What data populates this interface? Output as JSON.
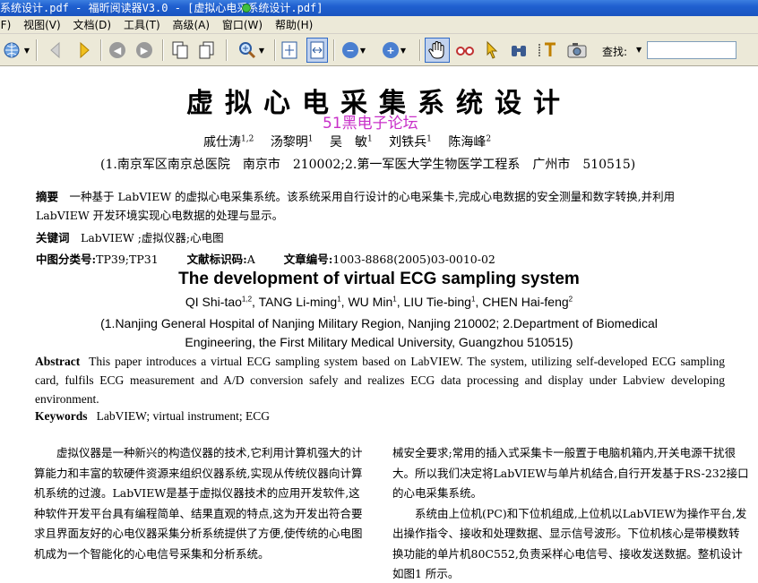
{
  "window": {
    "title_part1": "系统设计.pdf - 福昕阅读器V3.0 - [虚拟心电采",
    "title_part2": "系统设计.pdf]"
  },
  "menu": [
    "(F)",
    "视图(V)",
    "文档(D)",
    "工具(T)",
    "高级(A)",
    "窗口(W)",
    "帮助(H)"
  ],
  "toolbar": {
    "find_label": "查找:",
    "find_value": ""
  },
  "colors": {
    "titlebar": "#1f5fcf",
    "chrome": "#ece9d8",
    "watermark": "#c830c8"
  },
  "document": {
    "cn_title": "虚拟心电采集系统设计",
    "watermark": "51黑电子论坛",
    "cn_authors": [
      {
        "name": "戚仕涛",
        "sup": "1,2"
      },
      {
        "name": "汤黎明",
        "sup": "1"
      },
      {
        "name": "吴　敏",
        "sup": "1"
      },
      {
        "name": "刘铁兵",
        "sup": "1"
      },
      {
        "name": "陈海峰",
        "sup": "2"
      }
    ],
    "cn_affiliation": "(1.南京军区南京总医院　南京市　210002;2.第一军医大学生物医学工程系　广州市　510515)",
    "cn_abstract_label": "摘要",
    "cn_abstract": "一种基于 LabVIEW 的虚拟心电采集系统。该系统采用自行设计的心电采集卡,完成心电数据的安全测量和数字转换,并利用 LabVIEW 开发环境实现心电数据的处理与显示。",
    "cn_keywords_label": "关键词",
    "cn_keywords": "LabVIEW ;虚拟仪器;心电图",
    "cn_class_label": "中图分类号:",
    "cn_class": "TP39;TP31",
    "cn_doc_code_label": "文献标识码:",
    "cn_doc_code": "A",
    "cn_article_no_label": "文章编号:",
    "cn_article_no": "1003-8868(2005)03-0010-02",
    "en_title": "The development of virtual ECG sampling system",
    "en_authors": [
      {
        "name": "QI Shi-tao",
        "sup": "1,2"
      },
      {
        "name": "TANG Li-ming",
        "sup": "1"
      },
      {
        "name": "WU Min",
        "sup": "1"
      },
      {
        "name": "LIU Tie-bing",
        "sup": "1"
      },
      {
        "name": "CHEN Hai-feng",
        "sup": "2"
      }
    ],
    "en_affiliation_line1": "(1.Nanjing General Hospital of Nanjing Military Region, Nanjing 210002; 2.Department of Biomedical",
    "en_affiliation_line2": "Engineering, the First Military Medical University, Guangzhou 510515)",
    "en_abstract_label": "Abstract",
    "en_abstract": "This paper introduces a virtual ECG sampling system based on LabVIEW. The system, utilizing self-developed ECG sampling card, fulfils ECG measurement and A/D conversion safely and realizes ECG data processing and display under Labview developing environment.",
    "en_keywords_label": "Keywords",
    "en_keywords": "LabVIEW; virtual instrument; ECG",
    "left_col_p1": "虚拟仪器是一种新兴的构造仪器的技术,它利用计算机强大的计算能力和丰富的软硬件资源来组织仪器系统,实现从传统仪器向计算机系统的过渡。LabVIEW是基于虚拟仪器技术的应用开发软件,这种软件开发平台具有编程简单、结果直观的特点,这为开发出符合要求且界面友好的心电仪器采集分析系统提供了方便,使传统的心电图机成为一个智能化的心电信号采集和分析系统。",
    "right_col_p1": "械安全要求;常用的插入式采集卡一般置于电脑机箱内,开关电源干扰很大。所以我们决定将LabVIEW与单片机结合,自行开发基于RS-232接口的心电采集系统。",
    "right_col_p2": "系统由上位机(PC)和下位机组成,上位机以LabVIEW为操作平台,发出操作指令、接收和处理数据、显示信号波形。下位机核心是带模数转换功能的单片机80C552,负责采样心电信号、接收发送数据。整机设计如图1 所示。"
  }
}
